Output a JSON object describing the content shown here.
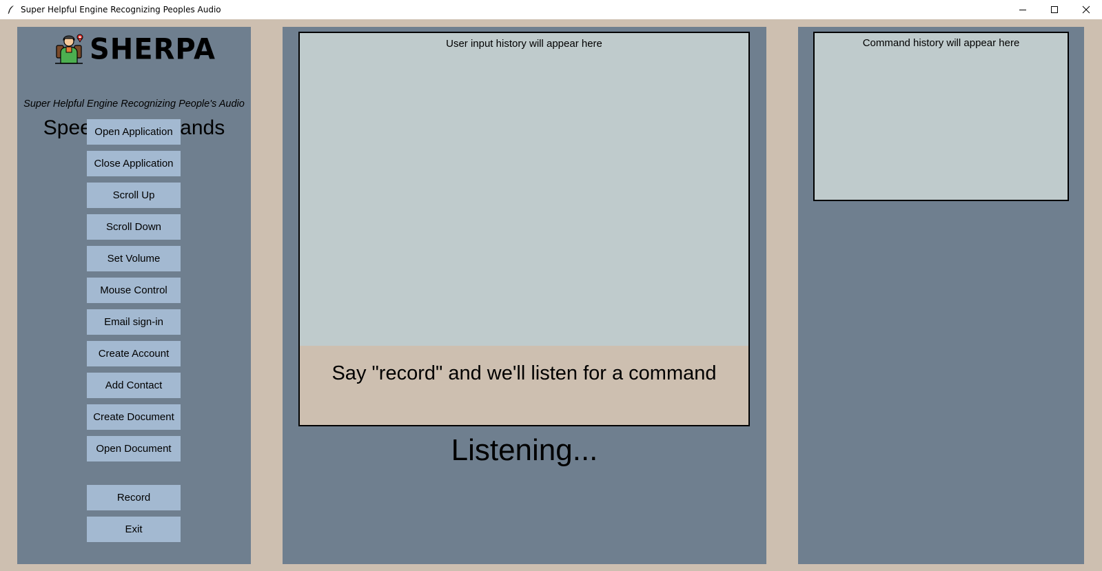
{
  "window": {
    "title": "Super Helpful Engine Recognizing Peoples Audio",
    "app_icon": "feather-icon",
    "controls": [
      "minimize-icon",
      "maximize-icon",
      "close-icon"
    ]
  },
  "sidebar": {
    "logo_text": "SHERPA",
    "tagline": "Super Helpful Engine Recognizing People's Audio",
    "section_title": "Speech Commands",
    "commands": [
      "Open Application",
      "Close Application",
      "Scroll Up",
      "Scroll Down",
      "Set Volume",
      "Mouse Control",
      "Email sign-in",
      "Create Account",
      "Add Contact",
      "Create Document",
      "Open Document"
    ],
    "record_label": "Record",
    "exit_label": "Exit"
  },
  "center": {
    "input_history_placeholder": "User input history will appear here",
    "prompt": "Say \"record\" and we'll listen for a command",
    "status": "Listening..."
  },
  "right": {
    "command_history_placeholder": "Command history will appear here"
  },
  "colors": {
    "background": "#cdbfb0",
    "panel": "#6f7f8f",
    "button": "#a3b9d1",
    "history_box": "#bfcbcc"
  }
}
